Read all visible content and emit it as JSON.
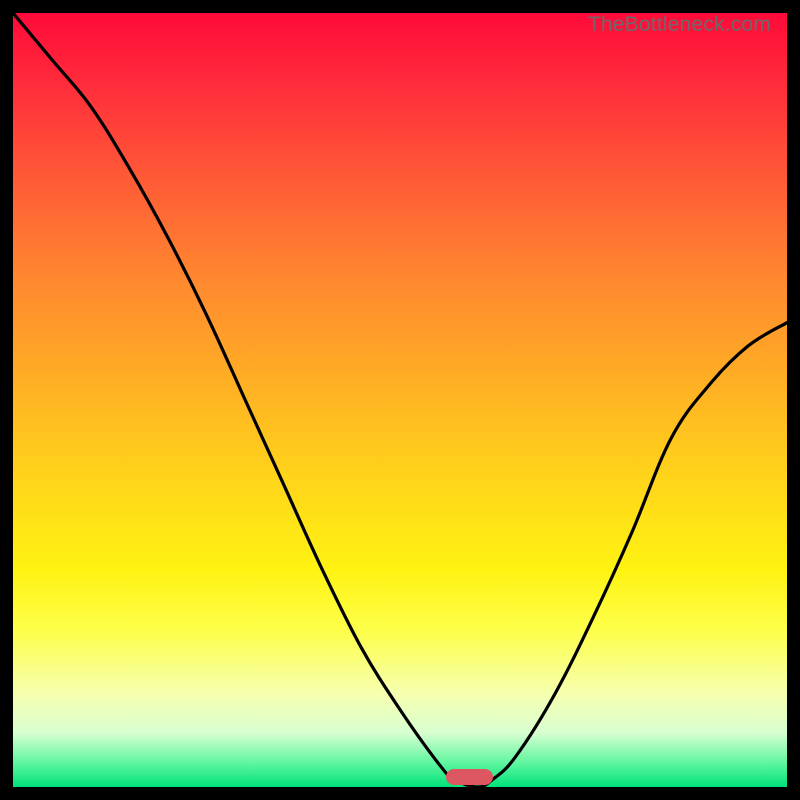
{
  "watermark": "TheBottleneck.com",
  "colors": {
    "frame": "#000000",
    "curve": "#000000",
    "marker": "#dc5760",
    "watermark_text": "#6a6a6a"
  },
  "chart_data": {
    "type": "line",
    "title": "",
    "xlabel": "",
    "ylabel": "",
    "xlim": [
      0,
      100
    ],
    "ylim": [
      0,
      100
    ],
    "grid": false,
    "legend": false,
    "series": [
      {
        "name": "bottleneck-curve",
        "x": [
          0,
          5,
          10,
          15,
          20,
          25,
          30,
          35,
          40,
          45,
          50,
          55,
          57,
          60,
          62,
          65,
          70,
          75,
          80,
          85,
          90,
          95,
          100
        ],
        "values": [
          100,
          94,
          88,
          80,
          71,
          61,
          50,
          39,
          28,
          18,
          10,
          3,
          1,
          0,
          1,
          4,
          12,
          22,
          33,
          45,
          52,
          57,
          60
        ]
      }
    ],
    "marker": {
      "x": 59,
      "width_pct": 6,
      "y": 0
    },
    "background_gradient_stops": [
      {
        "pct": 0,
        "color": "#ff0a3a"
      },
      {
        "pct": 10,
        "color": "#ff2f3b"
      },
      {
        "pct": 22,
        "color": "#ff5c36"
      },
      {
        "pct": 35,
        "color": "#ff8a2f"
      },
      {
        "pct": 48,
        "color": "#ffb024"
      },
      {
        "pct": 60,
        "color": "#ffd41a"
      },
      {
        "pct": 72,
        "color": "#fff313"
      },
      {
        "pct": 80,
        "color": "#fdff4c"
      },
      {
        "pct": 88,
        "color": "#f6ffb0"
      },
      {
        "pct": 93,
        "color": "#d8ffd0"
      },
      {
        "pct": 97,
        "color": "#5cf59e"
      },
      {
        "pct": 100,
        "color": "#00e27a"
      }
    ]
  }
}
